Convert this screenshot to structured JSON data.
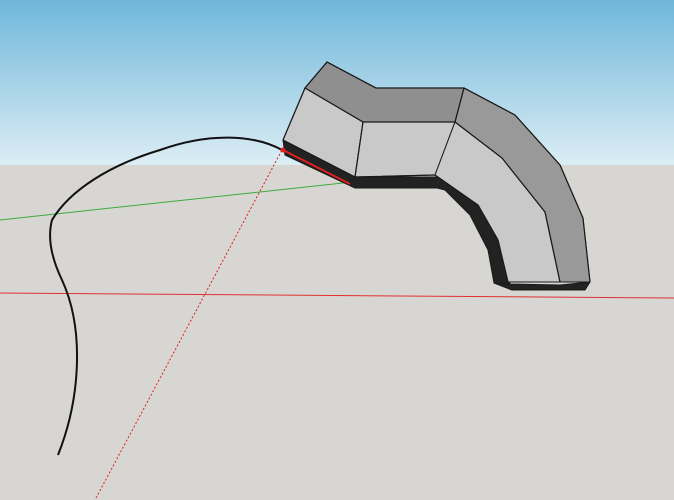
{
  "colors": {
    "sky_top": "#6fb7db",
    "sky_bottom": "#dcedf4",
    "ground": "#d7d6d2",
    "axis_red": "#e03030",
    "axis_green": "#3daa3d",
    "inference_red": "#e02020",
    "path_curve": "#111111",
    "face_top": "#8f8f8f",
    "face_front": "#c9c9c9",
    "face_outer": "#999999",
    "face_bottom": "#222222",
    "edge": "#1a1a1a"
  },
  "scene": {
    "type": "3d-modeling-viewport",
    "model": "follow-me-extrusion-elbow",
    "background": "sky-and-ground"
  }
}
